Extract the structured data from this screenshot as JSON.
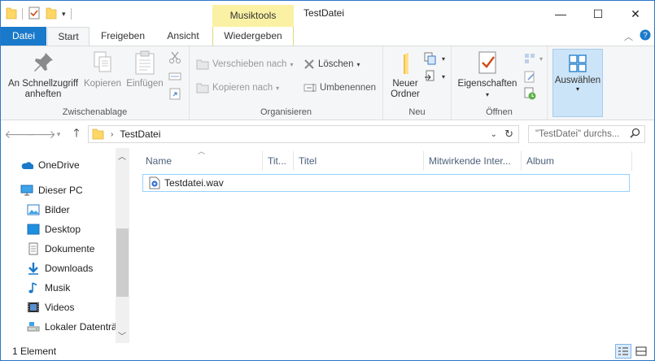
{
  "window": {
    "title": "TestDatei",
    "context_header": "Musiktools",
    "controls": {
      "minimize": "—",
      "maximize": "☐",
      "close": "✕"
    }
  },
  "tabs": {
    "file": "Datei",
    "start": "Start",
    "share": "Freigeben",
    "view": "Ansicht",
    "play": "Wiedergeben"
  },
  "ribbon": {
    "clipboard": {
      "label": "Zwischenablage",
      "pin_line1": "An Schnellzugriff",
      "pin_line2": "anheften",
      "copy": "Kopieren",
      "paste": "Einfügen"
    },
    "organize": {
      "label": "Organisieren",
      "move_to": "Verschieben nach",
      "copy_to": "Kopieren nach",
      "delete": "Löschen",
      "rename": "Umbenennen"
    },
    "new": {
      "label": "Neu",
      "new_folder_line1": "Neuer",
      "new_folder_line2": "Ordner"
    },
    "open": {
      "label": "Öffnen",
      "properties": "Eigenschaften"
    },
    "select": {
      "label": "Auswählen"
    }
  },
  "address": {
    "path": "TestDatei",
    "search_placeholder": "\"TestDatei\" durchs..."
  },
  "nav_pane": {
    "items": [
      {
        "label": "OneDrive",
        "icon": "onedrive-icon"
      },
      {
        "label": "Dieser PC",
        "icon": "pc-icon"
      },
      {
        "label": "Bilder",
        "icon": "pictures-icon"
      },
      {
        "label": "Desktop",
        "icon": "desktop-icon"
      },
      {
        "label": "Dokumente",
        "icon": "documents-icon"
      },
      {
        "label": "Downloads",
        "icon": "downloads-icon"
      },
      {
        "label": "Musik",
        "icon": "music-icon"
      },
      {
        "label": "Videos",
        "icon": "videos-icon"
      },
      {
        "label": "Lokaler Datenträ",
        "icon": "drive-icon"
      }
    ]
  },
  "columns": [
    "Name",
    "Tit...",
    "Titel",
    "Mitwirkende Inter...",
    "Album"
  ],
  "files": [
    {
      "name": "Testdatei.wav",
      "icon": "audio-file-icon"
    }
  ],
  "status": {
    "count": "1 Element"
  },
  "colors": {
    "file_tab": "#1979ca",
    "context_tab": "#fbf1a4",
    "selection": "#cce4f7",
    "folder": "#ffd766"
  }
}
